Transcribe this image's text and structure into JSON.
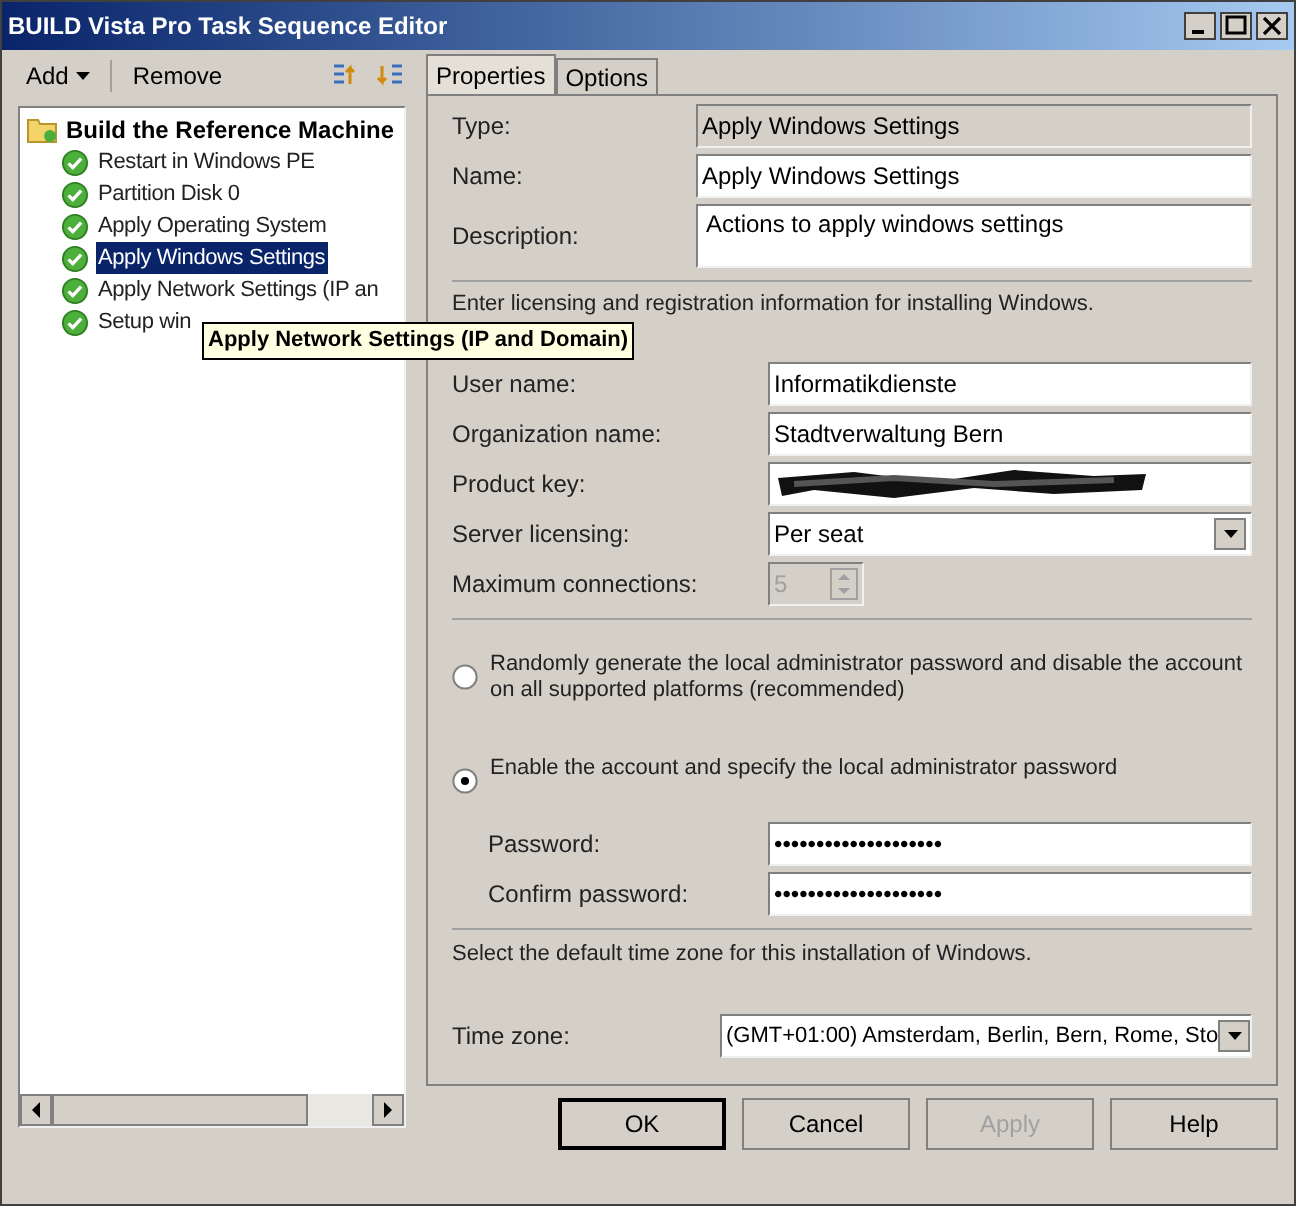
{
  "window": {
    "title": "BUILD Vista Pro Task Sequence Editor"
  },
  "toolbar": {
    "add": "Add",
    "remove": "Remove"
  },
  "tree": {
    "root": "Build the Reference Machine",
    "items": [
      {
        "label": "Restart in Windows PE",
        "selected": false
      },
      {
        "label": "Partition Disk 0",
        "selected": false
      },
      {
        "label": "Apply Operating System",
        "selected": false
      },
      {
        "label": "Apply Windows Settings",
        "selected": true
      },
      {
        "label": "Apply Network Settings (IP an",
        "selected": false
      },
      {
        "label": "Setup win",
        "selected": false
      }
    ]
  },
  "tooltip": "Apply Network Settings (IP and Domain)",
  "tabs": [
    {
      "label": "Properties",
      "selected": true
    },
    {
      "label": "Options",
      "selected": false
    }
  ],
  "header": [
    {
      "label": "Type:",
      "value": "Apply Windows Settings",
      "kind": "readonly"
    },
    {
      "label": "Name:",
      "value": "Apply Windows Settings",
      "kind": "text"
    },
    {
      "label": "Description:",
      "value": "Actions to apply windows settings",
      "kind": "multiline"
    }
  ],
  "licensing_intro": "Enter licensing and registration information for installing Windows.",
  "fields": [
    {
      "label": "User name:",
      "value": "Informatikdienste",
      "kind": "text"
    },
    {
      "label": "Organization name:",
      "value": "Stadtverwaltung Bern",
      "kind": "text"
    },
    {
      "label": "Product key:",
      "kind": "redacted"
    },
    {
      "label": "Server licensing:",
      "value": "Per seat",
      "kind": "select"
    },
    {
      "label": "Maximum connections:",
      "value": "5",
      "kind": "spin",
      "disabled": true
    }
  ],
  "radios": [
    {
      "label": "Randomly generate the local administrator password and disable the account on all supported platforms (recommended)",
      "selected": false
    },
    {
      "label": "Enable the account and specify the local administrator password",
      "selected": true
    }
  ],
  "passwords": [
    {
      "label": "Password:",
      "value": "••••••••••••••••••••"
    },
    {
      "label": "Confirm password:",
      "value": "••••••••••••••••••••"
    }
  ],
  "timezone_intro": "Select the default time zone for this installation of Windows.",
  "timezone": {
    "label": "Time zone:",
    "value": "(GMT+01:00) Amsterdam, Berlin, Bern, Rome, Sto"
  },
  "buttons": [
    {
      "label": "OK",
      "disabled": false,
      "default": true
    },
    {
      "label": "Cancel",
      "disabled": false,
      "default": false
    },
    {
      "label": "Apply",
      "disabled": true,
      "default": false
    },
    {
      "label": "Help",
      "disabled": false,
      "default": false
    }
  ]
}
